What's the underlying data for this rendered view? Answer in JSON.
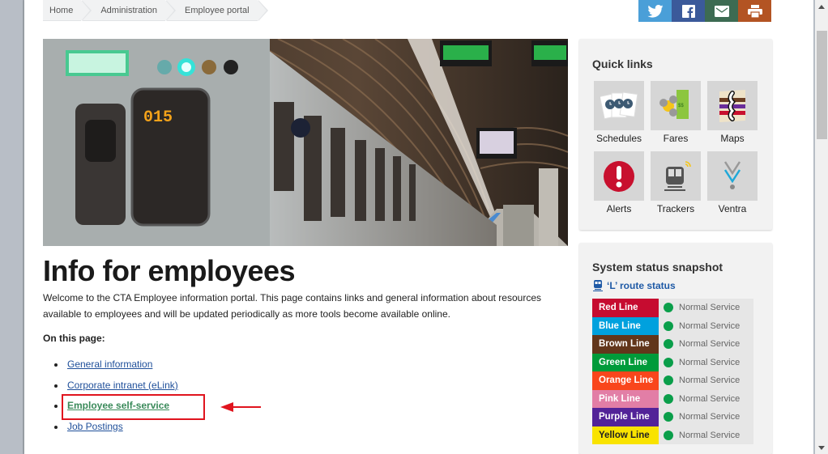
{
  "breadcrumb": [
    {
      "label": "Home"
    },
    {
      "label": "Administration"
    },
    {
      "label": "Employee portal"
    }
  ],
  "share": {
    "buttons": [
      {
        "name": "twitter",
        "color": "#4a9fd8"
      },
      {
        "name": "facebook",
        "color": "#3b5a9a"
      },
      {
        "name": "email",
        "color": "#3d6b52"
      },
      {
        "name": "print",
        "color": "#b35423"
      }
    ]
  },
  "hero": {
    "alt": "CTA train at platform",
    "train_number": "015"
  },
  "main": {
    "title": "Info for employees",
    "intro": "Welcome to the CTA Employee information portal. This page contains links and general information about resources available to employees and will be updated periodically as more tools become available online.",
    "on_this_page": "On this page:",
    "links": [
      {
        "label": "General information"
      },
      {
        "label": "Corporate intranet (eLink)"
      },
      {
        "label": "Employee self-service"
      },
      {
        "label": "Job Postings"
      }
    ]
  },
  "quick_links": {
    "title": "Quick links",
    "items": [
      {
        "label": "Schedules",
        "icon": "schedules-icon"
      },
      {
        "label": "Fares",
        "icon": "fares-icon"
      },
      {
        "label": "Maps",
        "icon": "maps-icon"
      },
      {
        "label": "Alerts",
        "icon": "alerts-icon"
      },
      {
        "label": "Trackers",
        "icon": "trackers-icon"
      },
      {
        "label": "Ventra",
        "icon": "ventra-icon"
      }
    ]
  },
  "system_status": {
    "title": "System status snapshot",
    "route_link": "‘L’ route status",
    "lines": [
      {
        "name": "Red Line",
        "color": "#c60c30",
        "text_color": "#ffffff",
        "status": "Normal Service"
      },
      {
        "name": "Blue Line",
        "color": "#00a1de",
        "text_color": "#ffffff",
        "status": "Normal Service"
      },
      {
        "name": "Brown Line",
        "color": "#62361b",
        "text_color": "#ffffff",
        "status": "Normal Service"
      },
      {
        "name": "Green Line",
        "color": "#009b3a",
        "text_color": "#ffffff",
        "status": "Normal Service"
      },
      {
        "name": "Orange Line",
        "color": "#f9461c",
        "text_color": "#ffffff",
        "status": "Normal Service"
      },
      {
        "name": "Pink Line",
        "color": "#e27ea6",
        "text_color": "#ffffff",
        "status": "Normal Service"
      },
      {
        "name": "Purple Line",
        "color": "#522398",
        "text_color": "#ffffff",
        "status": "Normal Service"
      },
      {
        "name": "Yellow Line",
        "color": "#f9e300",
        "text_color": "#222222",
        "status": "Normal Service"
      }
    ],
    "status_color": "#0a9e4a"
  },
  "annotation": {
    "highlight_color": "#e0141e"
  }
}
